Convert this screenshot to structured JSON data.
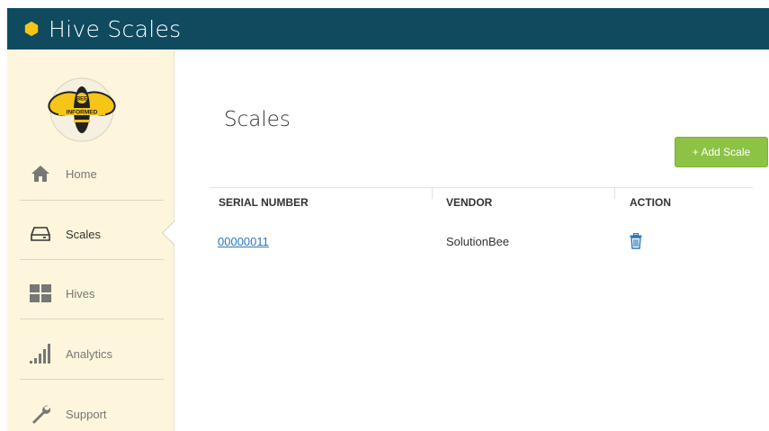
{
  "app": {
    "title": "Hive Scales",
    "brand_color": "#0f4a5f",
    "hex_color": "#f5c518"
  },
  "sidebar": {
    "logo": {
      "text_top": "BEE",
      "text_bottom": "INFORMED"
    },
    "items": [
      {
        "label": "Home",
        "icon": "home-icon",
        "active": false
      },
      {
        "label": "Scales",
        "icon": "scale-icon",
        "active": true
      },
      {
        "label": "Hives",
        "icon": "hives-grid-icon",
        "active": false
      },
      {
        "label": "Analytics",
        "icon": "bar-chart-icon",
        "active": false
      },
      {
        "label": "Support",
        "icon": "wrench-icon",
        "active": false
      }
    ]
  },
  "main": {
    "title": "Scales",
    "add_button_label": "+ Add Scale",
    "accent_color": "#8dc345",
    "table": {
      "headers": [
        "SERIAL NUMBER",
        "VENDOR",
        "ACTION"
      ],
      "rows": [
        {
          "serial": "00000011",
          "vendor": "SolutionBee",
          "action_icon": "trash-icon"
        }
      ]
    }
  }
}
